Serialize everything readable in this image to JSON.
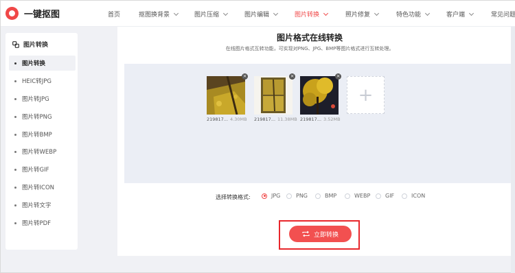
{
  "brand": {
    "name": "一键抠图",
    "color": "#f04848"
  },
  "nav": {
    "items": [
      {
        "label": "首页"
      },
      {
        "label": "抠图换背景"
      },
      {
        "label": "图片压缩"
      },
      {
        "label": "图片编辑"
      },
      {
        "label": "图片转换"
      },
      {
        "label": "照片修复"
      },
      {
        "label": "特色功能"
      },
      {
        "label": "客户端"
      },
      {
        "label": "常见问题"
      }
    ],
    "active": "图片转换"
  },
  "sidebar": {
    "heading": "图片转换",
    "items": [
      {
        "label": "图片转换"
      },
      {
        "label": "HEIC转JPG"
      },
      {
        "label": "图片转JPG"
      },
      {
        "label": "图片转PNG"
      },
      {
        "label": "图片转BMP"
      },
      {
        "label": "图片转WEBP"
      },
      {
        "label": "图片转GIF"
      },
      {
        "label": "图片转ICON"
      },
      {
        "label": "图片转文字"
      },
      {
        "label": "图片转PDF"
      }
    ],
    "active": "图片转换"
  },
  "main": {
    "title": "图片格式在线转换",
    "subtitle": "在线图片格式互转功能，可实现对PNG、JPG、BMP等图片格式进行互转处理。",
    "files": [
      {
        "name": "219817...",
        "size": "4.30MB"
      },
      {
        "name": "219817...",
        "size": "11.38MB"
      },
      {
        "name": "219817...",
        "size": "3.52MB"
      }
    ],
    "add_icon": "plus-icon",
    "format_label": "选择转换格式:",
    "formats": [
      "JPG",
      "PNG",
      "BMP",
      "WEBP",
      "GIF",
      "ICON"
    ],
    "selected_format": "JPG",
    "convert_button": "立即转换",
    "convert_icon": "convert-icon"
  }
}
